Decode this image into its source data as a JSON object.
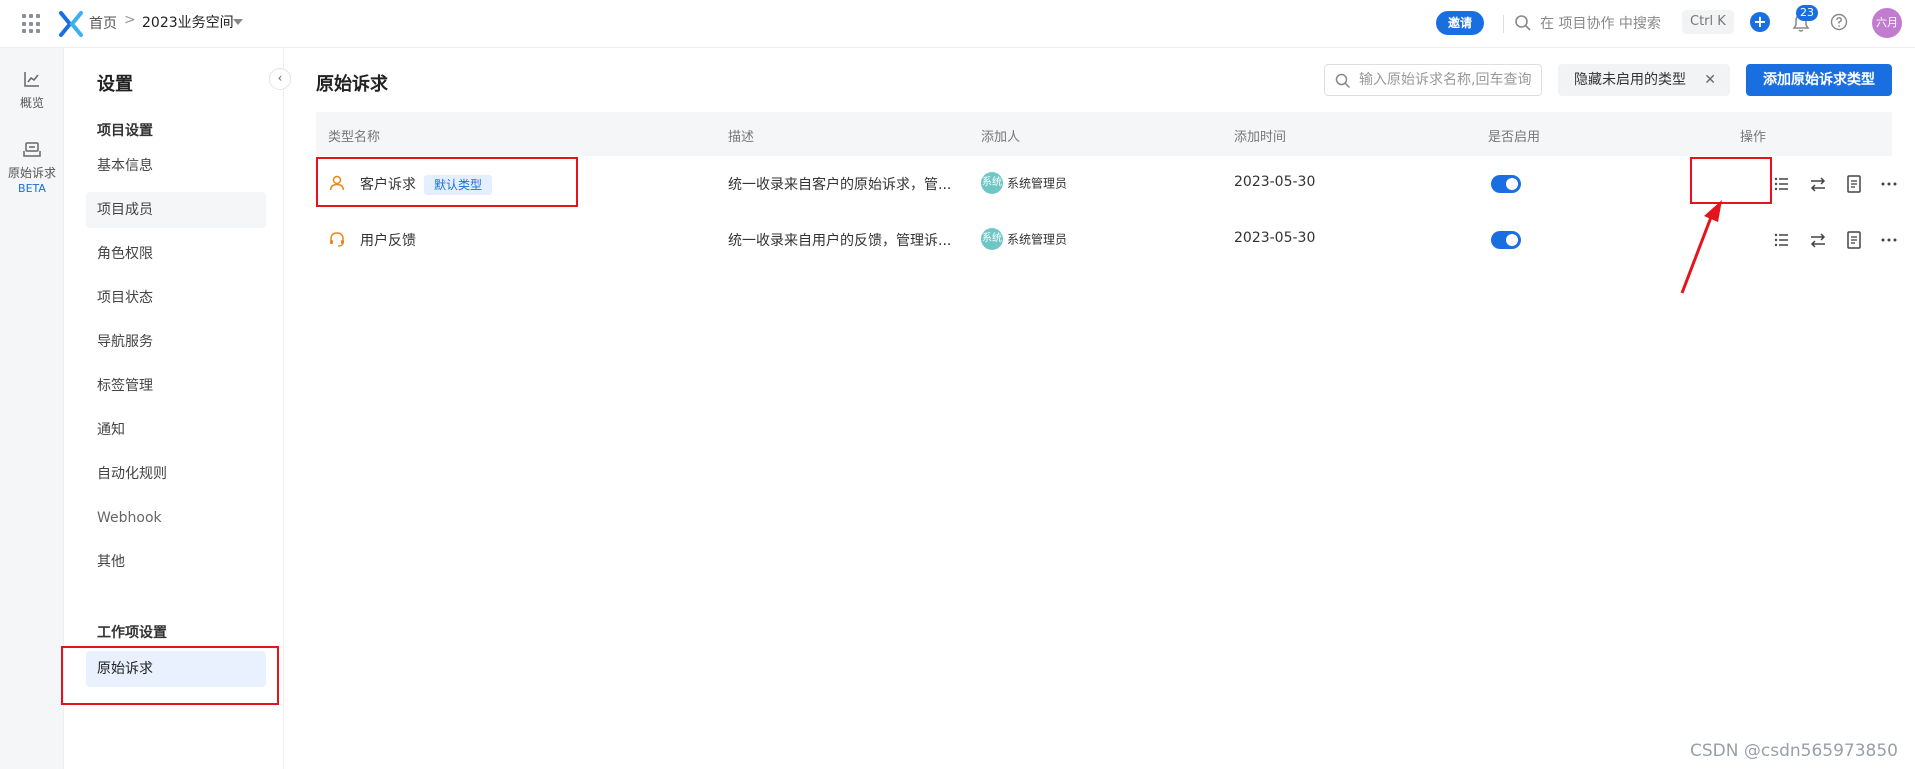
{
  "topbar": {
    "breadcrumb_home": "首页",
    "breadcrumb_sep": ">",
    "space_name": "2023业务空间",
    "invite_label": "邀请",
    "search_text": "在 项目协作 中搜索",
    "shortcut": "Ctrl K",
    "plus_label": "+",
    "notification_count": "23",
    "user_initials": "六月"
  },
  "rail": {
    "items": [
      {
        "label": "概览"
      },
      {
        "label": "原始诉求",
        "badge": "BETA"
      }
    ]
  },
  "settings": {
    "title": "设置",
    "collapse_label": "‹",
    "project_group": "项目设置",
    "project_items": [
      "基本信息",
      "项目成员",
      "角色权限",
      "项目状态",
      "导航服务",
      "标签管理",
      "通知",
      "自动化规则",
      "Webhook",
      "其他"
    ],
    "work_group": "工作项设置",
    "work_items": [
      "原始诉求"
    ]
  },
  "main": {
    "title": "原始诉求",
    "search_placeholder": "输入原始诉求名称,回车查询",
    "filter_label": "隐藏未启用的类型",
    "filter_clear": "✕",
    "add_label": "添加原始诉求类型",
    "columns": [
      "类型名称",
      "描述",
      "添加人",
      "添加时间",
      "是否启用",
      "操作"
    ],
    "rows": [
      {
        "name": "客户诉求",
        "tag": "默认类型",
        "desc": "统一收录来自客户的原始诉求，管...",
        "adder_avatar": "系统",
        "adder": "系统管理员",
        "date": "2023-05-30",
        "enabled": true
      },
      {
        "name": "用户反馈",
        "tag": "",
        "desc": "统一收录来自用户的反馈，管理诉...",
        "adder_avatar": "系统",
        "adder": "系统管理员",
        "date": "2023-05-30",
        "enabled": true
      }
    ]
  },
  "colors": {
    "accent": "#1a6fe0",
    "highlight": "#e5131b",
    "type_icon": "#e8891c"
  },
  "watermark": "CSDN @csdn565973850"
}
